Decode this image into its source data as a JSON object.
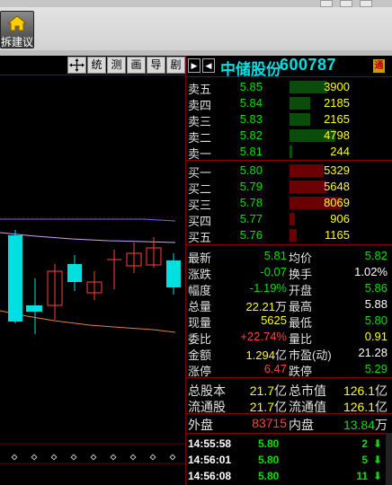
{
  "window": {
    "home_label": "拆建议"
  },
  "toolbar": {
    "buttons": [
      "统",
      "测",
      "画",
      "导",
      "剧"
    ]
  },
  "stock": {
    "name": "中储股份",
    "code": "600787",
    "badge": "通"
  },
  "asks": [
    {
      "label": "卖五",
      "price": "5.85",
      "volume": "3900",
      "bar": 0.72
    },
    {
      "label": "卖四",
      "price": "5.84",
      "volume": "2185",
      "bar": 0.4
    },
    {
      "label": "卖三",
      "price": "5.83",
      "volume": "2165",
      "bar": 0.4
    },
    {
      "label": "卖二",
      "price": "5.82",
      "volume": "4798",
      "bar": 0.88
    },
    {
      "label": "卖一",
      "price": "5.81",
      "volume": "244",
      "bar": 0.05
    }
  ],
  "bids": [
    {
      "label": "买一",
      "price": "5.80",
      "volume": "5329",
      "bar": 0.66
    },
    {
      "label": "买二",
      "price": "5.79",
      "volume": "5648",
      "bar": 0.7
    },
    {
      "label": "买三",
      "price": "5.78",
      "volume": "8069",
      "bar": 1.0
    },
    {
      "label": "买四",
      "price": "5.77",
      "volume": "906",
      "bar": 0.11
    },
    {
      "label": "买五",
      "price": "5.76",
      "volume": "1165",
      "bar": 0.14
    }
  ],
  "quote": [
    {
      "l": "最新",
      "v1": "5.81",
      "c1": "green",
      "r": "均价",
      "v2": "5.82",
      "c2": "green"
    },
    {
      "l": "涨跌",
      "v1": "-0.07",
      "c1": "green",
      "r": "换手",
      "v2": "1.02%",
      "c2": "white"
    },
    {
      "l": "幅度",
      "v1": "-1.19%",
      "c1": "green",
      "r": "开盘",
      "v2": "5.86",
      "c2": "green"
    },
    {
      "l": "总量",
      "v1": "22.21",
      "u1": "万",
      "c1": "yellow",
      "r": "最高",
      "v2": "5.88",
      "c2": "white"
    },
    {
      "l": "现量",
      "v1": "5625",
      "c1": "yellow",
      "r": "最低",
      "v2": "5.80",
      "c2": "green"
    },
    {
      "l": "委比",
      "v1": "+22.74%",
      "c1": "red",
      "r": "量比",
      "v2": "0.91",
      "c2": "yellow"
    },
    {
      "l": "金额",
      "v1": "1.294",
      "u1": "亿",
      "c1": "yellow",
      "r": "市盈(动)",
      "v2": "21.28",
      "c2": "white"
    },
    {
      "l": "涨停",
      "v1": "6.47",
      "c1": "red",
      "r": "跌停",
      "v2": "5.29",
      "c2": "green"
    }
  ],
  "capital": [
    {
      "l": "总股本",
      "v1": "21.7",
      "u1": "亿",
      "r": "总市值",
      "v2": "126.1",
      "u2": "亿"
    },
    {
      "l": "流通股",
      "v1": "21.7",
      "u1": "亿",
      "r": "流通值",
      "v2": "126.1",
      "u2": "亿"
    }
  ],
  "flow": {
    "outer_label": "外盘",
    "outer_value": "83715",
    "inner_label": "内盘",
    "inner_value": "13.84",
    "inner_unit": "万"
  },
  "ticks": [
    {
      "time": "14:55:58",
      "price": "5.80",
      "vol": "2",
      "dir": "down"
    },
    {
      "time": "14:56:01",
      "price": "5.80",
      "vol": "5",
      "dir": "down"
    },
    {
      "time": "14:56:08",
      "price": "5.80",
      "vol": "11",
      "dir": "down"
    }
  ],
  "colors": {
    "up": "#ff4040",
    "down": "#00e000",
    "volume": "#ffff00",
    "title": "#00e0e0",
    "border": "#8a0000"
  }
}
